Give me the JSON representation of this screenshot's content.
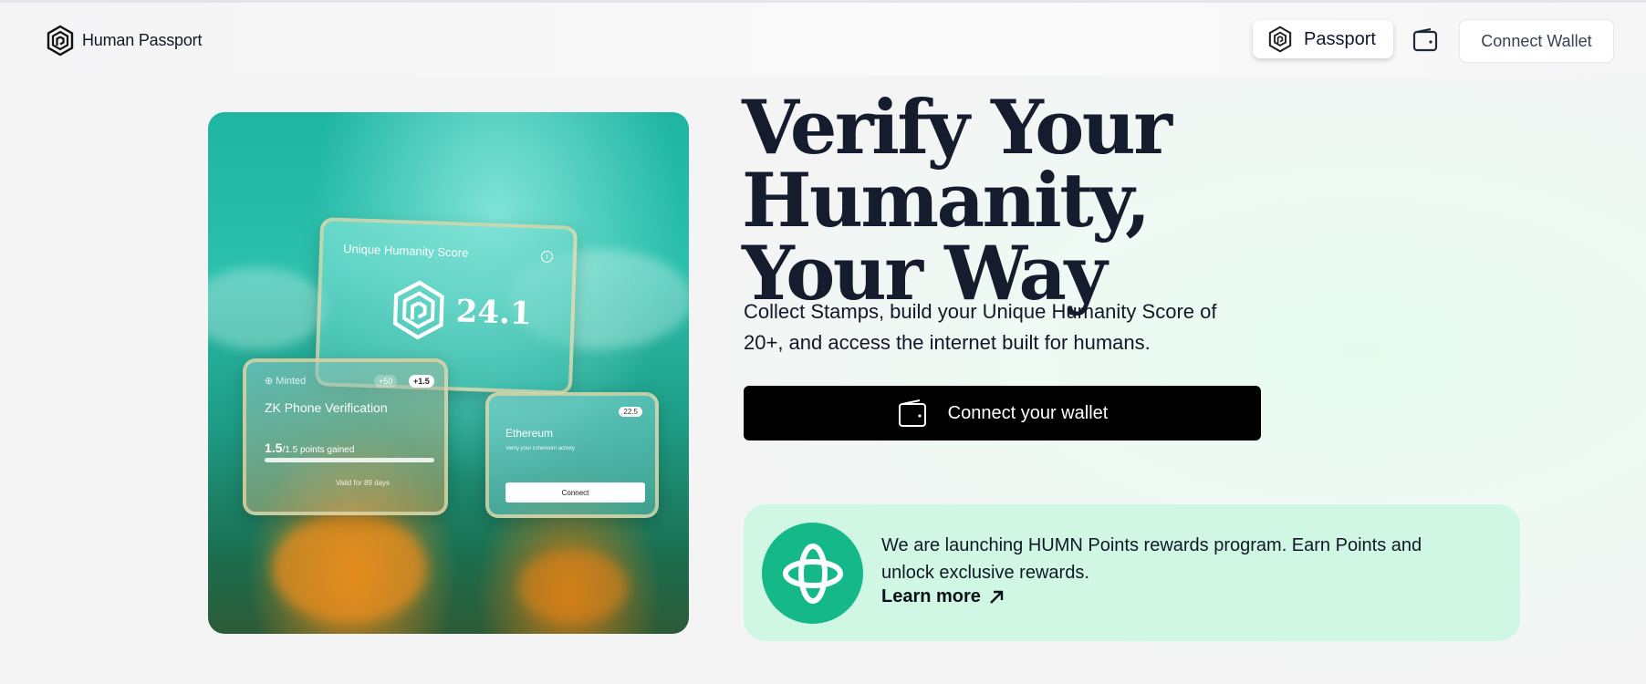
{
  "header": {
    "brand": "Human Passport",
    "passport_label": "Passport",
    "connect_wallet_label": "Connect Wallet"
  },
  "hero_image": {
    "score_card": {
      "title": "Unique Humanity Score",
      "score": "24.1"
    },
    "phone_card": {
      "status": "Minted",
      "badge_a": "+50",
      "badge_b": "+1.5",
      "name": "ZK Phone Verification",
      "points_value": "1.5",
      "points_total": "/1.5",
      "points_label": "points gained",
      "validity": "Valid for 89 days"
    },
    "eth_card": {
      "badge": "22.5",
      "name": "Ethereum",
      "description": "Verify your Ethereum activity",
      "button": "Connect"
    }
  },
  "main": {
    "headline_line1": "Verify Your Humanity,",
    "headline_line2": "Your Way",
    "subtext": "Collect Stamps, build your Unique Humanity Score of 20+, and access the internet built for humans.",
    "cta_label": "Connect your wallet"
  },
  "promo": {
    "text": "We are launching HUMN Points rewards program. Earn Points and unlock exclusive rewards.",
    "link_label": "Learn more"
  },
  "colors": {
    "accent_green": "#14b889",
    "promo_bg": "#cff7e3",
    "headline": "#141c2e",
    "cta_bg": "#000000"
  }
}
